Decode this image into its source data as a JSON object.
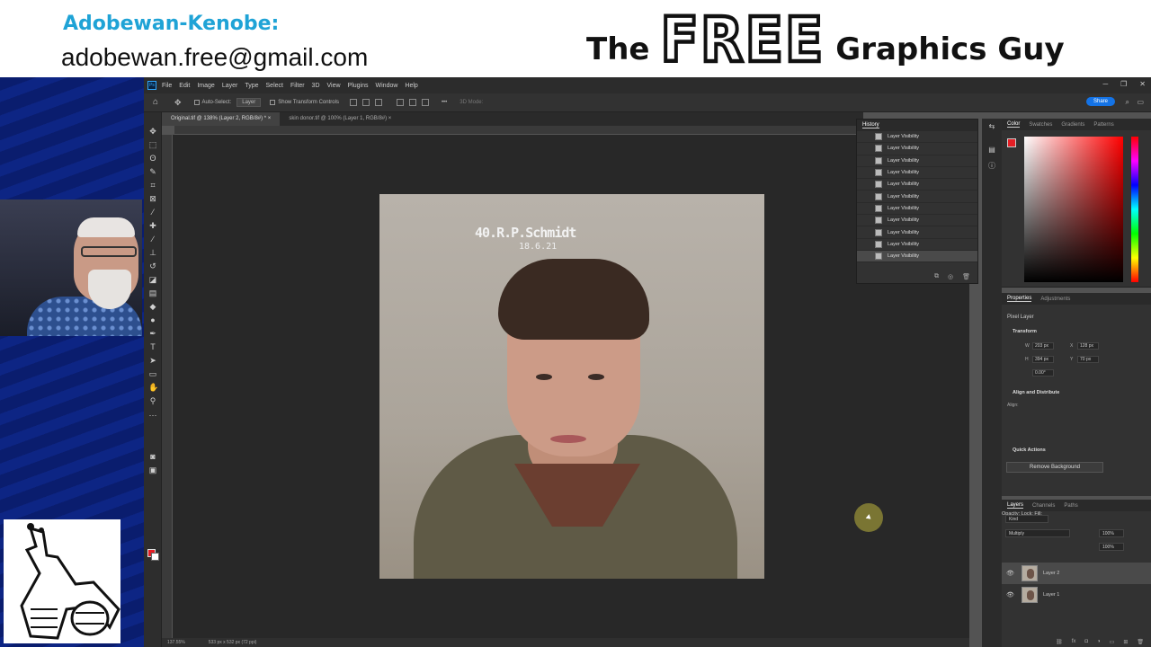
{
  "banner": {
    "name": "Adobewan-Kenobe:",
    "email": "adobewan.free@gmail.com",
    "brand_the": "The",
    "brand_free": "FREE",
    "brand_rest": "Graphics Guy"
  },
  "ps": {
    "logo": "Ps",
    "menu": [
      "File",
      "Edit",
      "Image",
      "Layer",
      "Type",
      "Select",
      "Filter",
      "3D",
      "View",
      "Plugins",
      "Window",
      "Help"
    ],
    "options": {
      "auto_select": "Auto-Select:",
      "auto_select_target": "Layer",
      "transform_controls": "Show Transform Controls",
      "mode_3d": "3D Mode:"
    },
    "share": "Share",
    "tabs": [
      "Original.tif @ 138% (Layer 2, RGB/8#) *",
      "skin donor.tif @ 100% (Layer 1, RGB/8#)"
    ],
    "photo_caption_1": "40.R.P.Schmidt",
    "photo_caption_2": "18.6.21",
    "status": {
      "zoom": "137.55%",
      "doc": "533 px x 532 px (72 ppi)"
    },
    "history": {
      "tab": "History",
      "items": [
        "Layer Visibility",
        "Layer Visibility",
        "Layer Visibility",
        "Layer Visibility",
        "Layer Visibility",
        "Layer Visibility",
        "Layer Visibility",
        "Layer Visibility",
        "Layer Visibility",
        "Layer Visibility",
        "Layer Visibility"
      ],
      "selected_index": 10
    },
    "color_panel": {
      "tabs": [
        "Color",
        "Swatches",
        "Gradients",
        "Patterns"
      ],
      "fg": "#e41e25",
      "bg": "#ffffff"
    },
    "properties": {
      "tabs": [
        "Properties",
        "Adjustments"
      ],
      "kind": "Pixel Layer",
      "transform_title": "Transform",
      "w_label": "W",
      "w": "203 px",
      "x_label": "X",
      "x": "128 px",
      "h_label": "H",
      "h": "394 px",
      "y_label": "Y",
      "y": "70 px",
      "angle": "0.00°",
      "align_title": "Align and Distribute",
      "align_label": "Align:",
      "quick_actions": "Quick Actions",
      "remove_bg": "Remove Background"
    },
    "layers": {
      "tabs": [
        "Layers",
        "Channels",
        "Paths"
      ],
      "kind": "Kind",
      "blend": "Multiply",
      "opacity_label": "Opacity:",
      "opacity": "100%",
      "lock_label": "Lock:",
      "fill_label": "Fill:",
      "fill": "100%",
      "rows": [
        {
          "name": "Layer 2",
          "selected": true
        },
        {
          "name": "Layer 1",
          "selected": false
        }
      ]
    }
  }
}
